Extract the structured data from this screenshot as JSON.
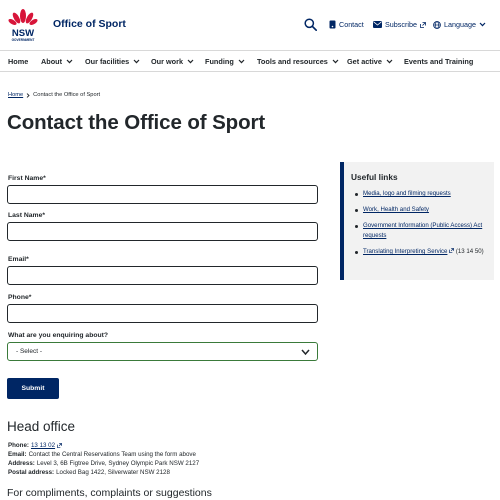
{
  "header": {
    "logo_text": "NSW",
    "logo_subtext": "GOVERNMENT",
    "site_title": "Office of Sport",
    "contact_label": "Contact",
    "subscribe_label": "Subscribe",
    "language_label": "Language",
    "brand_color": "#002664",
    "waratah_color": "#d7153a"
  },
  "nav": {
    "items": [
      {
        "label": "Home",
        "has_menu": false
      },
      {
        "label": "About",
        "has_menu": true
      },
      {
        "label": "Our facilities",
        "has_menu": true
      },
      {
        "label": "Our work",
        "has_menu": true
      },
      {
        "label": "Funding",
        "has_menu": true
      },
      {
        "label": "Tools and resources",
        "has_menu": true
      },
      {
        "label": "Get active",
        "has_menu": true
      },
      {
        "label": "Events and Training",
        "has_menu": false
      }
    ]
  },
  "breadcrumb": {
    "home": "Home",
    "current": "Contact the Office of Sport"
  },
  "page_title": "Contact the Office of Sport",
  "form": {
    "first_name_label": "First Name*",
    "last_name_label": "Last Name*",
    "email_label": "Email*",
    "phone_label": "Phone*",
    "enquiry_label": "What are you enquiring about?",
    "enquiry_value": "- Select -",
    "submit_label": "Submit"
  },
  "sidebar": {
    "title": "Useful links",
    "links": [
      {
        "label": "Media, logo and filming requests",
        "suffix": ""
      },
      {
        "label": "Work, Health and Safety",
        "suffix": ""
      },
      {
        "label": "Government Information (Public Access) Act requests",
        "suffix": ""
      },
      {
        "label": "Translating Interpreting Service",
        "suffix": "(13 14 50)"
      }
    ]
  },
  "head_office": {
    "title": "Head office",
    "phone_label": "Phone:",
    "phone_value": "13 13 02",
    "email_label": "Email:",
    "email_value": "Contact the Central Reservations Team using the form above",
    "address_label": "Address:",
    "address_value": "Level 3, 6B Figtree Drive, Sydney Olympic Park NSW 2127",
    "postal_label": "Postal address:",
    "postal_value": "Locked Bag 1422, Silverwater NSW 2128"
  },
  "feedback_heading": "For compliments, complaints or suggestions"
}
